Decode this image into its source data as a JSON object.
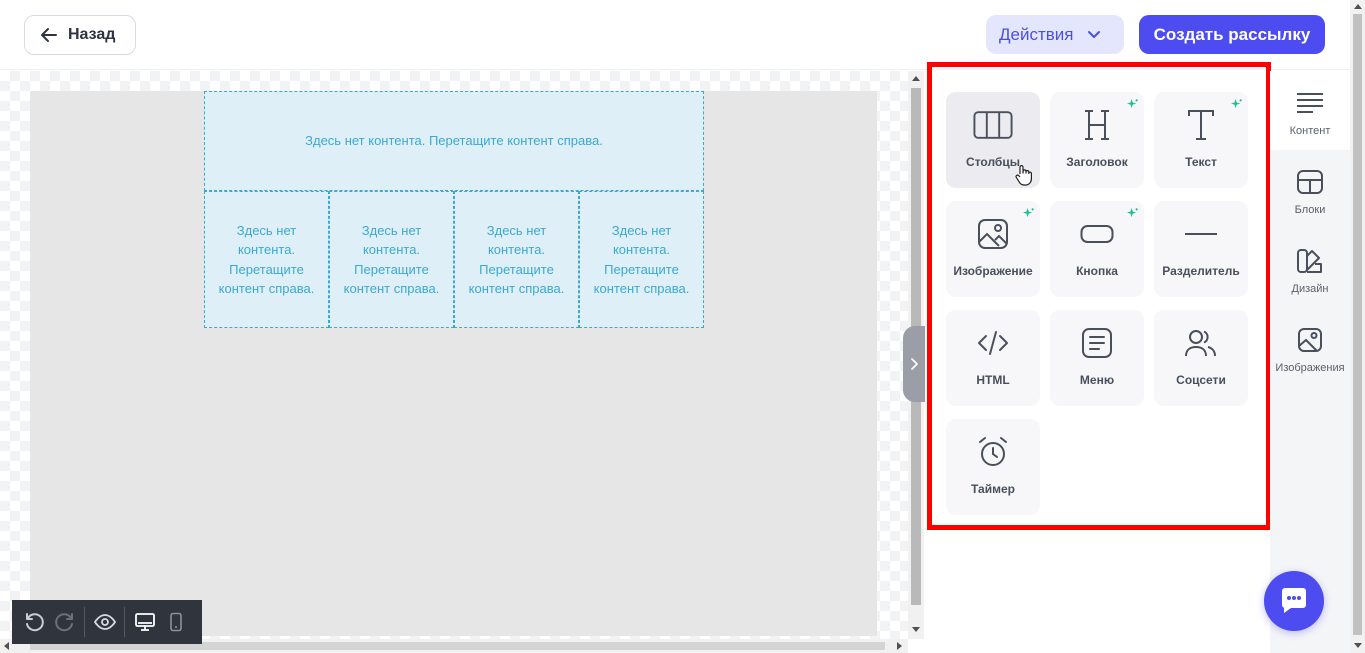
{
  "header": {
    "back_label": "Назад",
    "actions_label": "Действия",
    "create_label": "Создать рассылку"
  },
  "canvas": {
    "top_placeholder": "Здесь нет контента. Перетащите контент справа.",
    "column_placeholders": [
      "Здесь нет контента. Перетащите контент справа.",
      "Здесь нет контента. Перетащите контент справа.",
      "Здесь нет контента. Перетащите контент справа.",
      "Здесь нет контента. Перетащите контент справа."
    ]
  },
  "content_panel": {
    "tiles": [
      {
        "label": "Столбцы",
        "icon": "columns-icon"
      },
      {
        "label": "Заголовок",
        "icon": "heading-icon"
      },
      {
        "label": "Текст",
        "icon": "text-icon"
      },
      {
        "label": "Изображение",
        "icon": "image-icon"
      },
      {
        "label": "Кнопка",
        "icon": "button-shape-icon"
      },
      {
        "label": "Разделитель",
        "icon": "divider-icon"
      },
      {
        "label": "HTML",
        "icon": "code-icon"
      },
      {
        "label": "Меню",
        "icon": "menu-icon"
      },
      {
        "label": "Соцсети",
        "icon": "social-icon"
      },
      {
        "label": "Таймер",
        "icon": "alarm-clock-icon"
      }
    ]
  },
  "sidebar": {
    "items": [
      {
        "label": "Контент",
        "icon": "content-lines-icon"
      },
      {
        "label": "Блоки",
        "icon": "blocks-icon"
      },
      {
        "label": "Дизайн",
        "icon": "design-icon"
      },
      {
        "label": "Изображения",
        "icon": "images-icon"
      }
    ]
  },
  "colors": {
    "accent": "#4d4cf0",
    "accent_light": "#e4e6fe",
    "dropzone_border": "#3aa9d1",
    "sparkle": "#1ebc8f",
    "highlight": "#ff0000"
  }
}
